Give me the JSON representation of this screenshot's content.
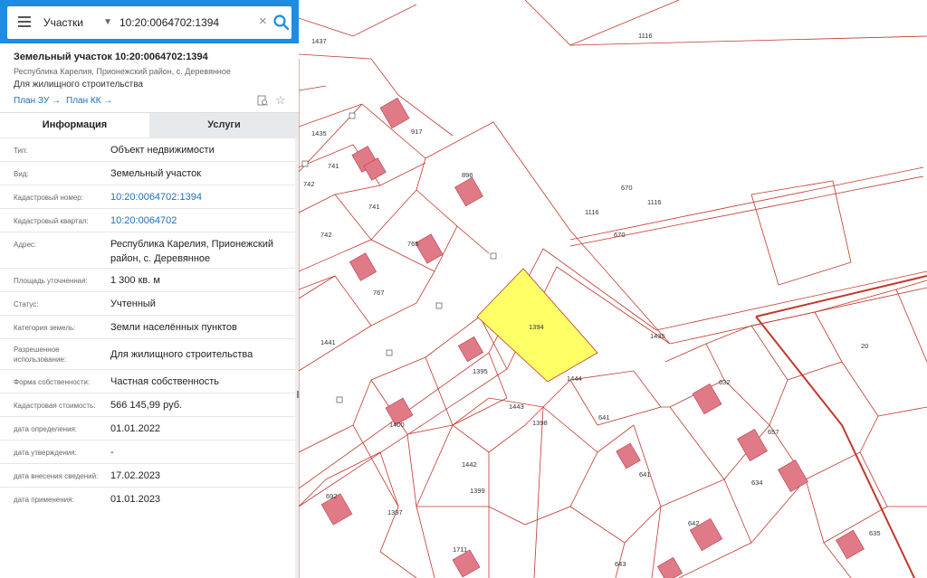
{
  "search": {
    "category": "Участки",
    "query": "10:20:0064702:1394"
  },
  "parcel": {
    "title": "Земельный участок 10:20:0064702:1394",
    "region": "Республика Карелия, Прионежский район, с. Деревянное",
    "purpose": "Для жилищного строительства",
    "links": {
      "plan_zu": "План ЗУ →",
      "plan_kk": "План КК →"
    }
  },
  "tabs": {
    "info": "Информация",
    "services": "Услуги"
  },
  "info_rows": [
    {
      "label": "Тип:",
      "value": "Объект недвижимости"
    },
    {
      "label": "Вид:",
      "value": "Земельный участок"
    },
    {
      "label": "Кадастровый номер:",
      "value": "10:20:0064702:1394"
    },
    {
      "label": "Кадастровый квартал:",
      "value": "10:20:0064702"
    },
    {
      "label": "Адрес:",
      "value": "Республика Карелия, Прионежский район, с. Деревянное"
    },
    {
      "label": "Площадь уточненная:",
      "value": "1 300 кв. м"
    },
    {
      "label": "Статус:",
      "value": "Учтенный"
    },
    {
      "label": "Категория земель:",
      "value": "Земли населённых пунктов"
    },
    {
      "label": "Разрешенное использование:",
      "value": "Для жилищного строительства"
    },
    {
      "label": "Форма собственности:",
      "value": "Частная собственность"
    },
    {
      "label": "Кадастровая стоимость:",
      "value": "566 145,99 руб."
    },
    {
      "label": "дата определения:",
      "value": "01.01.2022"
    },
    {
      "label": "дата утверждения:",
      "value": "-"
    },
    {
      "label": "дата внесения сведений:",
      "value": "17.02.2023"
    },
    {
      "label": "дата применения:",
      "value": "01.01.2023"
    }
  ],
  "map": {
    "parcel_labels": [
      "1437",
      "1116",
      "1435",
      "917",
      "741",
      "896",
      "742",
      "741",
      "1116",
      "670",
      "670",
      "742",
      "765",
      "1116",
      "767",
      "1441",
      "1394",
      "1435",
      "1395",
      "1444",
      "632",
      "20",
      "1443",
      "1398",
      "641",
      "657",
      "1400",
      "1442",
      "634",
      "1399",
      "641",
      "692",
      "1397",
      "642",
      "1711",
      "643",
      "635"
    ],
    "colors": {
      "selected_fill": "#ffff66",
      "boundary": "#c0392b",
      "building": "#e07a86",
      "accent": "#1d8ce3"
    }
  }
}
